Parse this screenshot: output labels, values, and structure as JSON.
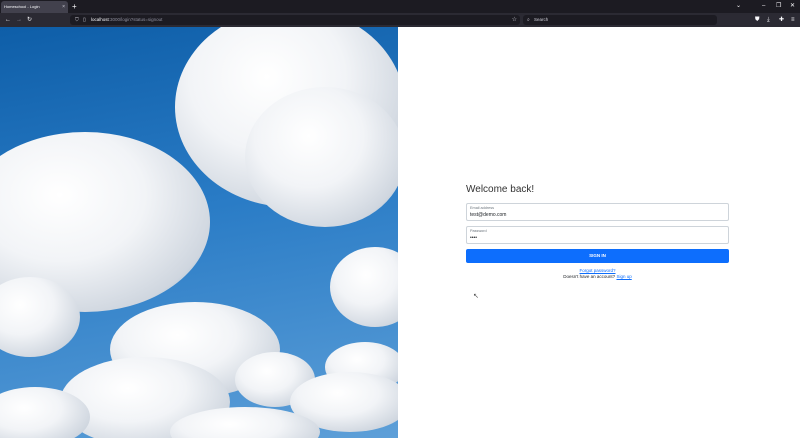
{
  "browser": {
    "tab_title": "Homeschool - Login",
    "tab_close": "×",
    "new_tab": "+",
    "url_host": "localhost",
    "url_path": ":3000/login?status=signout",
    "search_placeholder": "Search"
  },
  "form": {
    "heading": "Welcome back!",
    "email_label": "Email address",
    "email_value": "test@demo.com",
    "password_label": "Password",
    "password_value": "••••",
    "signin_label": "SIGN IN",
    "forgot_label": "Forgot password?",
    "no_account_text": "Doesn't have an account?",
    "signup_label": "Sign up"
  },
  "colors": {
    "accent": "#0d6efd",
    "browser_bg": "#1c1b22",
    "toolbar_bg": "#2b2a33"
  },
  "icons": [
    "shield-icon",
    "page-icon",
    "star-icon",
    "search-icon",
    "back-icon",
    "forward-icon",
    "reload-icon",
    "pocket-icon",
    "download-icon",
    "extensions-icon",
    "menu-icon"
  ]
}
